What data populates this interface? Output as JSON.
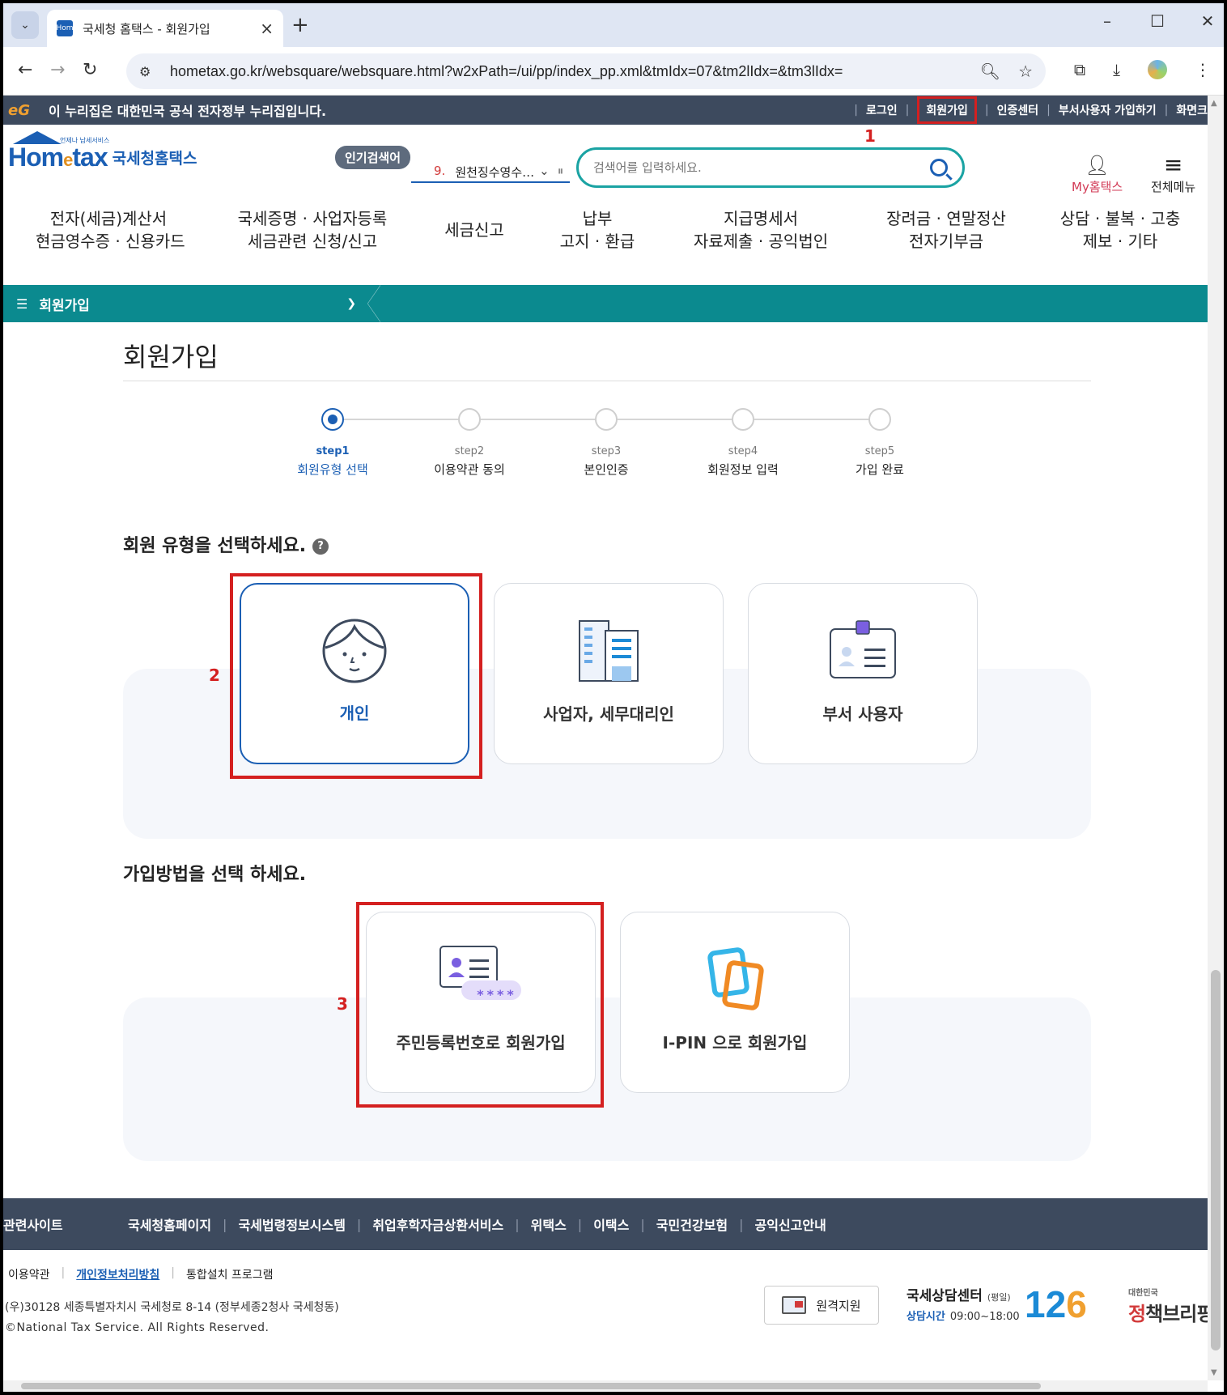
{
  "browser": {
    "tab_title": "국세청 홈택스 - 회원가입",
    "favicon_text": "Hom",
    "url": "hometax.go.kr/websquare/websquare.html?w2xPath=/ui/pp/index_pp.xml&tmIdx=07&tm2lIdx=&tm3lIdx="
  },
  "gov_banner": {
    "text": "이 누리집은 대한민국 공식 전자정부 누리집입니다.",
    "links": [
      "로그인",
      "회원가입",
      "인증센터",
      "부서사용자 가입하기",
      "화면크"
    ]
  },
  "annotations": {
    "a1": "1",
    "a2": "2",
    "a3": "3"
  },
  "header": {
    "logo_word": "Hom",
    "logo_e": "e",
    "logo_tax": "tax",
    "logo_small": "언제나 납세서비스",
    "logo_kr": "국세청홈택스",
    "popular_badge": "인기검색어",
    "popular_rank": "9.",
    "popular_term": "원천징수영수…",
    "search_placeholder": "검색어를 입력하세요.",
    "my_hometax": "My홈택스",
    "all_menu": "전체메뉴"
  },
  "gnb": [
    {
      "l1": "전자(세금)계산서",
      "l2": "현금영수증 · 신용카드"
    },
    {
      "l1": "국세증명 · 사업자등록",
      "l2": "세금관련 신청/신고"
    },
    {
      "l1": "세금신고",
      "l2": ""
    },
    {
      "l1": "납부",
      "l2": "고지 · 환급"
    },
    {
      "l1": "지급명세서",
      "l2": "자료제출 · 공익법인"
    },
    {
      "l1": "장려금 · 연말정산",
      "l2": "전자기부금"
    },
    {
      "l1": "상담 · 불복 · 고충",
      "l2": "제보 · 기타"
    }
  ],
  "subbar": {
    "label": "회원가입"
  },
  "main": {
    "title": "회원가입",
    "steps": [
      {
        "num": "step1",
        "name": "회원유형 선택"
      },
      {
        "num": "step2",
        "name": "이용약관 동의"
      },
      {
        "num": "step3",
        "name": "본인인증"
      },
      {
        "num": "step4",
        "name": "회원정보 입력"
      },
      {
        "num": "step5",
        "name": "가입 완료"
      }
    ],
    "member_type_title": "회원 유형을 선택하세요.",
    "help": "?",
    "member_types": [
      "개인",
      "사업자, 세무대리인",
      "부서 사용자"
    ],
    "join_method_title": "가입방법을 선택 하세요.",
    "join_methods": [
      "주민등록번호로 회원가입",
      "I-PIN 으로 회원가입"
    ],
    "rrn_mask": "****"
  },
  "footer": {
    "related_head": "관련사이트",
    "sites": [
      "국세청홈페이지",
      "국세법령정보시스템",
      "취업후학자금상환서비스",
      "위택스",
      "이택스",
      "국민건강보험",
      "공익신고안내"
    ],
    "links": [
      "이용약관",
      "개인정보처리방침",
      "통합설치 프로그램"
    ],
    "address": "(우)30128 세종특별자치시 국세청로 8-14 (정부세종2청사 국세청동)",
    "copyright": "©National Tax Service. All Rights Reserved.",
    "remote_support": "원격지원",
    "call_center": "국세상담센터",
    "weekday": "(평일)",
    "hours_label": "상담시간",
    "hours": "09:00~18:00",
    "call_number": [
      "1",
      "2",
      "6"
    ],
    "briefing_small": "대한민국",
    "briefing_red": "정",
    "briefing_rest": "책브리핑"
  },
  "colors": {
    "teal": "#0b8a8f",
    "navy_bar": "#3d4a5e",
    "brand_blue": "#1b5fb4",
    "annotation_red": "#d42020"
  }
}
